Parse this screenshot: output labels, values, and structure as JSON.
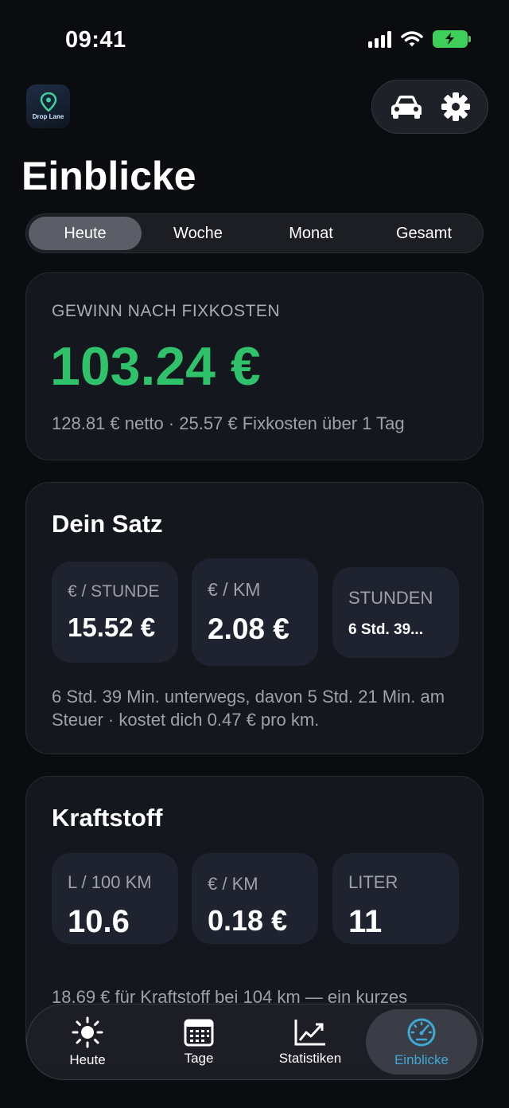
{
  "status_bar": {
    "time": "09:41"
  },
  "header": {
    "app_logo_text": "Drop Lane",
    "title": "Einblicke"
  },
  "segments": [
    {
      "label": "Heute",
      "active": true
    },
    {
      "label": "Woche",
      "active": false
    },
    {
      "label": "Monat",
      "active": false
    },
    {
      "label": "Gesamt",
      "active": false
    }
  ],
  "profit_card": {
    "label": "GEWINN NACH FIXKOSTEN",
    "value": "103.24 €",
    "subtitle": "128.81 € netto · 25.57 € Fixkosten über 1 Tag"
  },
  "rate_card": {
    "title": "Dein Satz",
    "tiles": [
      {
        "label": "€ / STUNDE",
        "value": "15.52 €"
      },
      {
        "label": "€ / KM",
        "value": "2.08 €"
      },
      {
        "label": "STUNDEN",
        "value": "6 Std. 39..."
      }
    ],
    "note": "6 Std. 39 Min. unterwegs, davon 5 Std. 21 Min. am Steuer · kostet dich 0.47 € pro km."
  },
  "fuel_card": {
    "title": "Kraftstoff",
    "tiles": [
      {
        "label": "L / 100 KM",
        "value": "10.6"
      },
      {
        "label": "€ / KM",
        "value": "0.18 €"
      },
      {
        "label": "LITER",
        "value": "11"
      }
    ],
    "note": "18.69 € für Kraftstoff bei 104 km — ein kurzes"
  },
  "tabbar": [
    {
      "label": "Heute",
      "icon": "sun-icon",
      "active": false
    },
    {
      "label": "Tage",
      "icon": "calendar-icon",
      "active": false
    },
    {
      "label": "Statistiken",
      "icon": "chart-icon",
      "active": false
    },
    {
      "label": "Einblicke",
      "icon": "speedometer-icon",
      "active": true
    }
  ],
  "colors": {
    "background": "#0b0c10",
    "profit_green": "#2fc26a",
    "active_tab_blue": "#3fa9d6",
    "battery_green": "#3ecf5a"
  }
}
